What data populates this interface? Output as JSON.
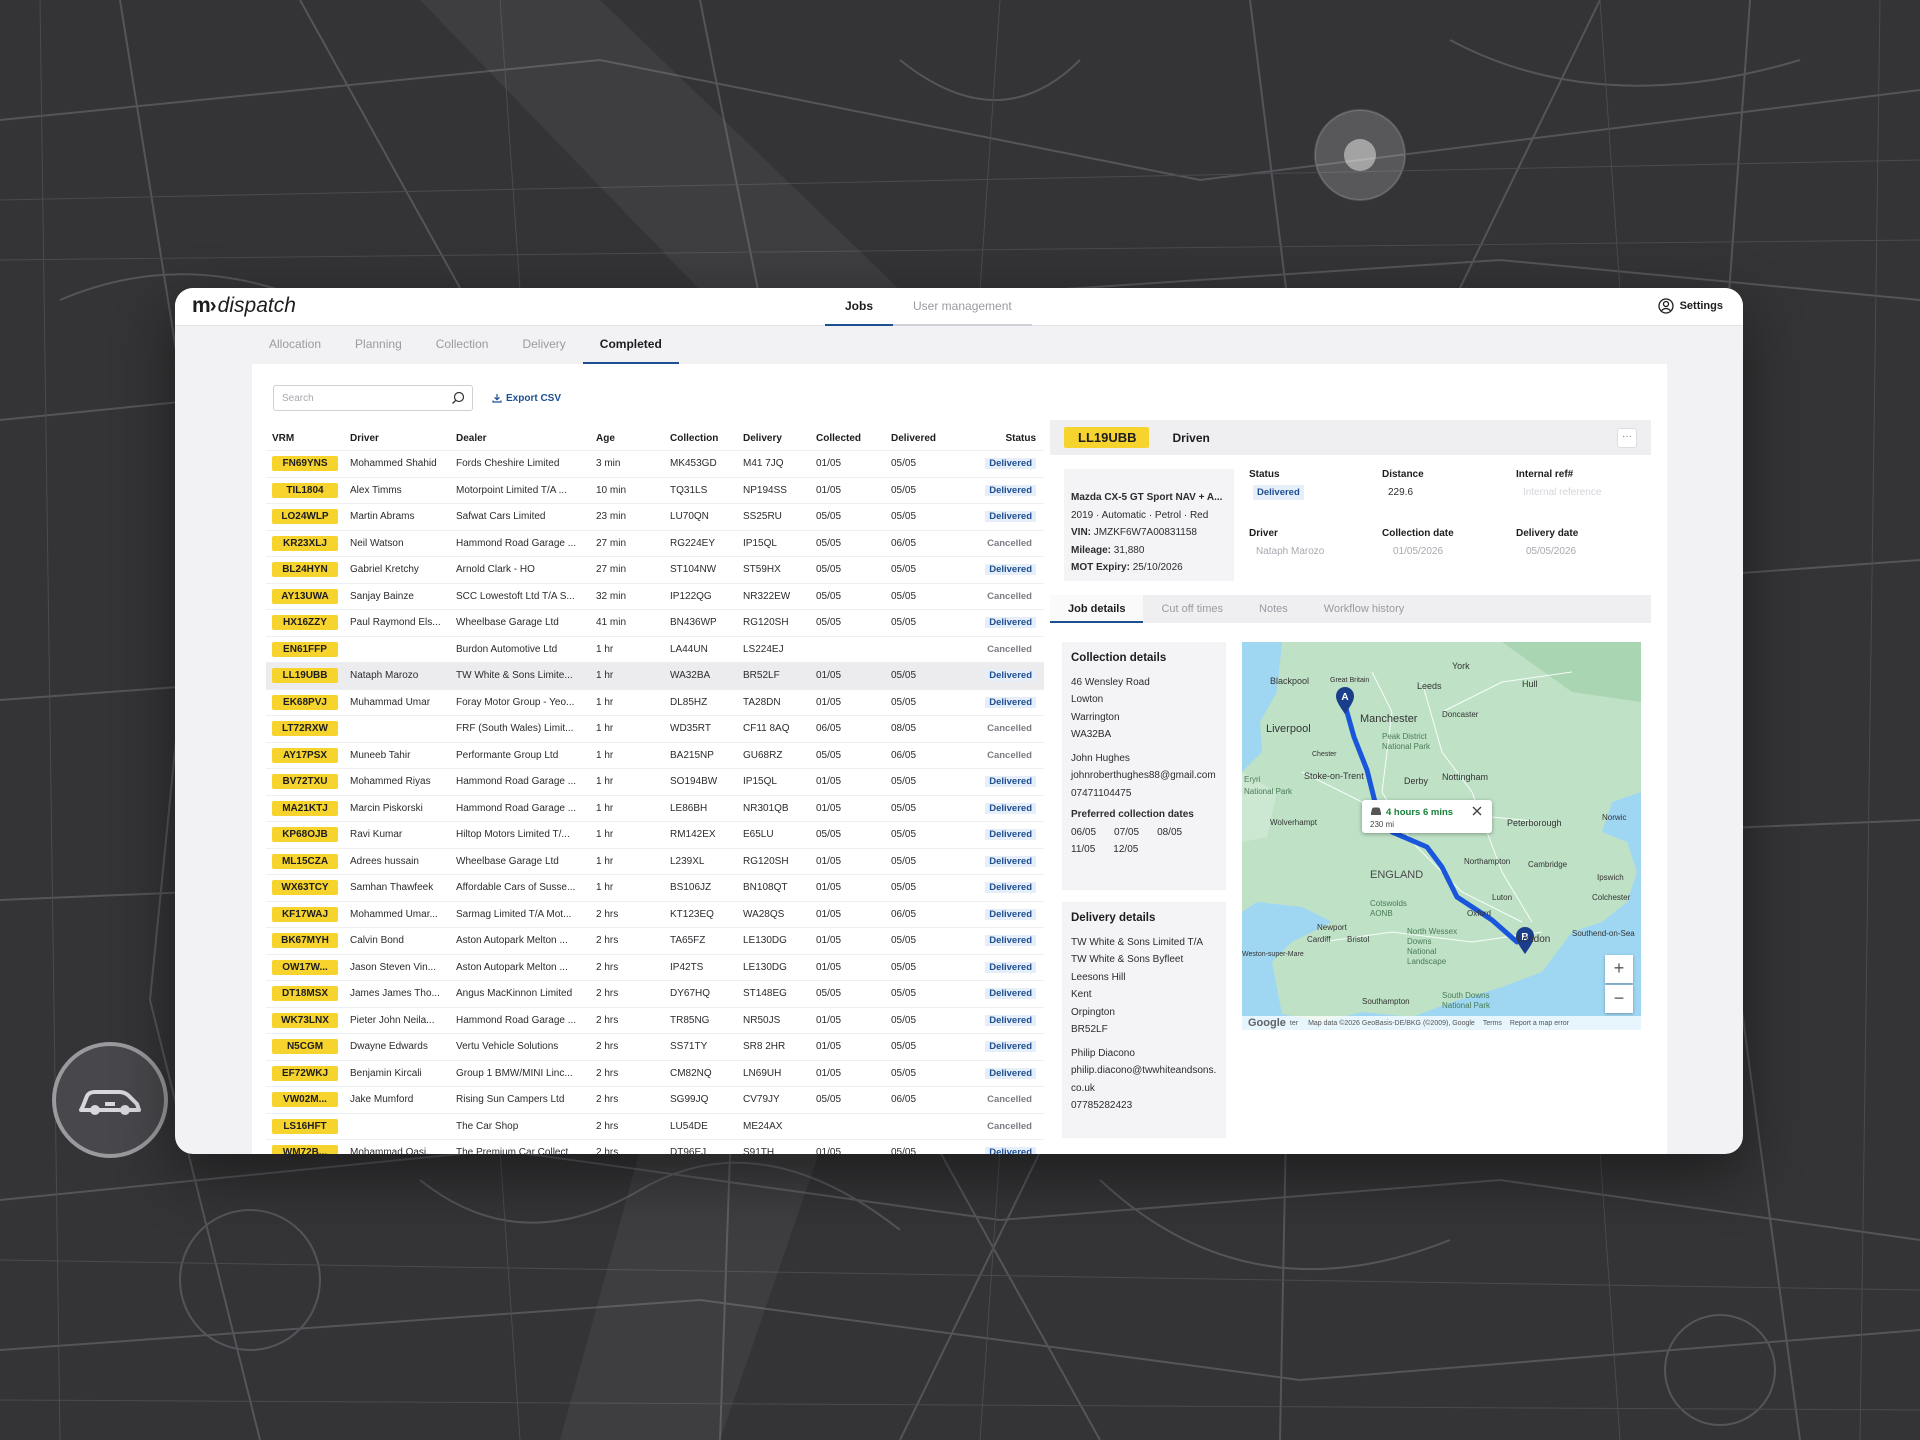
{
  "app": {
    "logo_mark": "m›",
    "logo_text": "dispatch",
    "top_tabs": [
      {
        "label": "Jobs",
        "active": true
      },
      {
        "label": "User management",
        "active": false
      }
    ],
    "settings_label": "Settings"
  },
  "subtabs": [
    {
      "label": "Allocation",
      "active": false
    },
    {
      "label": "Planning",
      "active": false
    },
    {
      "label": "Collection",
      "active": false
    },
    {
      "label": "Delivery",
      "active": false
    },
    {
      "label": "Completed",
      "active": true
    }
  ],
  "toolbar": {
    "search_placeholder": "Search",
    "search_value": "",
    "export_label": "Export CSV"
  },
  "table": {
    "columns": [
      "VRM",
      "Driver",
      "Dealer",
      "Age",
      "Collection",
      "Delivery",
      "Collected",
      "Delivered",
      "Status"
    ],
    "rows": [
      {
        "vrm": "FN69YNS",
        "driver": "Mohammed Shahid",
        "dealer": "Fords Cheshire Limited",
        "age": "3 min",
        "collection": "MK453GD",
        "delivery": "M41 7JQ",
        "collected": "01/05",
        "delivered": "05/05",
        "status": "Delivered"
      },
      {
        "vrm": "TIL1804",
        "driver": "Alex Timms",
        "dealer": "Motorpoint Limited T/A ...",
        "age": "10 min",
        "collection": "TQ31LS",
        "delivery": "NP194SS",
        "collected": "01/05",
        "delivered": "05/05",
        "status": "Delivered"
      },
      {
        "vrm": "LO24WLP",
        "driver": "Martin Abrams",
        "dealer": "Safwat Cars Limited",
        "age": "23 min",
        "collection": "LU70QN",
        "delivery": "SS25RU",
        "collected": "05/05",
        "delivered": "05/05",
        "status": "Delivered"
      },
      {
        "vrm": "KR23XLJ",
        "driver": "Neil Watson",
        "dealer": "Hammond Road Garage ...",
        "age": "27 min",
        "collection": "RG224EY",
        "delivery": "IP15QL",
        "collected": "05/05",
        "delivered": "06/05",
        "status": "Cancelled"
      },
      {
        "vrm": "BL24HYN",
        "driver": "Gabriel Kretchy",
        "dealer": "Arnold Clark - HO",
        "age": "27 min",
        "collection": "ST104NW",
        "delivery": "ST59HX",
        "collected": "05/05",
        "delivered": "05/05",
        "status": "Delivered"
      },
      {
        "vrm": "AY13UWA",
        "driver": "Sanjay Bainze",
        "dealer": "SCC Lowestoft Ltd T/A S...",
        "age": "32 min",
        "collection": "IP122QG",
        "delivery": "NR322EW",
        "collected": "05/05",
        "delivered": "05/05",
        "status": "Cancelled"
      },
      {
        "vrm": "HX16ZZY",
        "driver": "Paul Raymond Els...",
        "dealer": "Wheelbase Garage Ltd",
        "age": "41 min",
        "collection": "BN436WP",
        "delivery": "RG120SH",
        "collected": "05/05",
        "delivered": "05/05",
        "status": "Delivered"
      },
      {
        "vrm": "EN61FFP",
        "driver": "",
        "dealer": "Burdon Automotive Ltd",
        "age": "1 hr",
        "collection": "LA44UN",
        "delivery": "LS224EJ",
        "collected": "",
        "delivered": "",
        "status": "Cancelled"
      },
      {
        "vrm": "LL19UBB",
        "driver": "Nataph Marozo",
        "dealer": "TW White & Sons Limite...",
        "age": "1 hr",
        "collection": "WA32BA",
        "delivery": "BR52LF",
        "collected": "01/05",
        "delivered": "05/05",
        "status": "Delivered",
        "selected": true
      },
      {
        "vrm": "EK68PVJ",
        "driver": "Muhammad Umar",
        "dealer": "Foray Motor Group - Yeo...",
        "age": "1 hr",
        "collection": "DL85HZ",
        "delivery": "TA28DN",
        "collected": "01/05",
        "delivered": "05/05",
        "status": "Delivered"
      },
      {
        "vrm": "LT72RXW",
        "driver": "",
        "dealer": "FRF (South Wales) Limit...",
        "age": "1 hr",
        "collection": "WD35RT",
        "delivery": "CF11 8AQ",
        "collected": "06/05",
        "delivered": "08/05",
        "status": "Cancelled"
      },
      {
        "vrm": "AY17PSX",
        "driver": "Muneeb Tahir",
        "dealer": "Performante Group Ltd",
        "age": "1 hr",
        "collection": "BA215NP",
        "delivery": "GU68RZ",
        "collected": "05/05",
        "delivered": "06/05",
        "status": "Cancelled"
      },
      {
        "vrm": "BV72TXU",
        "driver": "Mohammed Riyas",
        "dealer": "Hammond Road Garage ...",
        "age": "1 hr",
        "collection": "SO194BW",
        "delivery": "IP15QL",
        "collected": "01/05",
        "delivered": "05/05",
        "status": "Delivered"
      },
      {
        "vrm": "MA21KTJ",
        "driver": "Marcin Piskorski",
        "dealer": "Hammond Road Garage ...",
        "age": "1 hr",
        "collection": "LE86BH",
        "delivery": "NR301QB",
        "collected": "01/05",
        "delivered": "05/05",
        "status": "Delivered"
      },
      {
        "vrm": "KP68OJB",
        "driver": "Ravi Kumar",
        "dealer": "Hiltop Motors Limited T/...",
        "age": "1 hr",
        "collection": "RM142EX",
        "delivery": "E65LU",
        "collected": "05/05",
        "delivered": "05/05",
        "status": "Delivered"
      },
      {
        "vrm": "ML15CZA",
        "driver": "Adrees hussain",
        "dealer": "Wheelbase Garage Ltd",
        "age": "1 hr",
        "collection": "L239XL",
        "delivery": "RG120SH",
        "collected": "01/05",
        "delivered": "05/05",
        "status": "Delivered"
      },
      {
        "vrm": "WX63TCY",
        "driver": "Samhan Thawfeek",
        "dealer": "Affordable Cars of Susse...",
        "age": "1 hr",
        "collection": "BS106JZ",
        "delivery": "BN108QT",
        "collected": "01/05",
        "delivered": "05/05",
        "status": "Delivered"
      },
      {
        "vrm": "KF17WAJ",
        "driver": "Mohammed Umar...",
        "dealer": "Sarmag Limited T/A Mot...",
        "age": "2 hrs",
        "collection": "KT123EQ",
        "delivery": "WA28QS",
        "collected": "01/05",
        "delivered": "06/05",
        "status": "Delivered"
      },
      {
        "vrm": "BK67MYH",
        "driver": "Calvin Bond",
        "dealer": "Aston Autopark Melton ...",
        "age": "2 hrs",
        "collection": "TA65FZ",
        "delivery": "LE130DG",
        "collected": "01/05",
        "delivered": "05/05",
        "status": "Delivered"
      },
      {
        "vrm": "OW17W...",
        "driver": "Jason Steven Vin...",
        "dealer": "Aston Autopark Melton ...",
        "age": "2 hrs",
        "collection": "IP42TS",
        "delivery": "LE130DG",
        "collected": "01/05",
        "delivered": "05/05",
        "status": "Delivered"
      },
      {
        "vrm": "DT18MSX",
        "driver": "James James Tho...",
        "dealer": "Angus MacKinnon Limited",
        "age": "2 hrs",
        "collection": "DY67HQ",
        "delivery": "ST148EG",
        "collected": "05/05",
        "delivered": "05/05",
        "status": "Delivered"
      },
      {
        "vrm": "WK73LNX",
        "driver": "Pieter John Neila...",
        "dealer": "Hammond Road Garage ...",
        "age": "2 hrs",
        "collection": "TR85NG",
        "delivery": "NR50JS",
        "collected": "01/05",
        "delivered": "05/05",
        "status": "Delivered"
      },
      {
        "vrm": "N5CGM",
        "driver": "Dwayne Edwards",
        "dealer": "Vertu Vehicle Solutions",
        "age": "2 hrs",
        "collection": "SS71TY",
        "delivery": "SR8 2HR",
        "collected": "01/05",
        "delivered": "05/05",
        "status": "Delivered"
      },
      {
        "vrm": "EF72WKJ",
        "driver": "Benjamin Kircali",
        "dealer": "Group 1 BMW/MINI Linc...",
        "age": "2 hrs",
        "collection": "CM82NQ",
        "delivery": "LN69UH",
        "collected": "01/05",
        "delivered": "05/05",
        "status": "Delivered"
      },
      {
        "vrm": "VW02M...",
        "driver": "Jake Mumford",
        "dealer": "Rising Sun Campers Ltd",
        "age": "2 hrs",
        "collection": "SG99JQ",
        "delivery": "CV79JY",
        "collected": "05/05",
        "delivered": "06/05",
        "status": "Cancelled"
      },
      {
        "vrm": "LS16HFT",
        "driver": "",
        "dealer": "The Car Shop",
        "age": "2 hrs",
        "collection": "LU54DE",
        "delivery": "ME24AX",
        "collected": "",
        "delivered": "",
        "status": "Cancelled"
      },
      {
        "vrm": "WM72B...",
        "driver": "Mohammad Qasi...",
        "dealer": "The Premium Car Collect...",
        "age": "2 hrs",
        "collection": "DT96EJ",
        "delivery": "S91TH",
        "collected": "01/05",
        "delivered": "05/05",
        "status": "Delivered"
      }
    ]
  },
  "detail": {
    "vrm": "LL19UBB",
    "job_type": "Driven",
    "more_label": "···",
    "vehicle": {
      "model": "Mazda CX-5 GT Sport NAV + A...",
      "specs": "2019 · Automatic · Petrol · Red",
      "vin_label": "VIN:",
      "vin": "JMZKF6W7A00831158",
      "mileage_label": "Mileage:",
      "mileage": "31,880",
      "mot_label": "MOT Expiry:",
      "mot": "25/10/2026"
    },
    "status_label": "Status",
    "status": "Delivered",
    "distance_label": "Distance",
    "distance": "229.6",
    "internal_ref_label": "Internal ref#",
    "internal_ref_placeholder": "Internal reference",
    "driver_label": "Driver",
    "driver": "Nataph Marozo",
    "collection_date_label": "Collection date",
    "collection_date": "01/05/2026",
    "delivery_date_label": "Delivery date",
    "delivery_date": "05/05/2026",
    "tabs": [
      {
        "label": "Job details",
        "active": true
      },
      {
        "label": "Cut off times",
        "active": false
      },
      {
        "label": "Notes",
        "active": false
      },
      {
        "label": "Workflow history",
        "active": false
      }
    ],
    "collection": {
      "title": "Collection details",
      "address": [
        "46 Wensley Road",
        "Lowton",
        "Warrington",
        "WA32BA"
      ],
      "contact_name": "John Hughes",
      "contact_email": "johnroberthughes88@gmail.com",
      "contact_phone": "07471104475",
      "preferred_title": "Preferred collection dates",
      "preferred_dates": [
        "06/05",
        "07/05",
        "08/05",
        "11/05",
        "12/05"
      ]
    },
    "delivery": {
      "title": "Delivery details",
      "address": [
        "TW White & Sons Limited T/A",
        "TW White & Sons Byfleet",
        "Leesons Hill",
        "Kent",
        "Orpington",
        "BR52LF"
      ],
      "contact_name": "Philip Diacono",
      "contact_email": "philip.diacono@twwhiteandsons.co.uk",
      "contact_phone": "07785282423"
    },
    "map": {
      "route_time": "4 hours 6 mins",
      "route_distance": "230 mi",
      "marker_a": "A",
      "marker_b": "B",
      "labels": {
        "york": "York",
        "leeds": "Leeds",
        "hull": "Hull",
        "blackpool": "Blackpool",
        "great_britain": "Great Britain",
        "manchester": "Manchester",
        "liverpool": "Liverpool",
        "doncaster": "Doncaster",
        "chester": "Chester",
        "peak": "Peak District",
        "national_park": "National Park",
        "stoke": "Stoke-on-Trent",
        "derby": "Derby",
        "nottingham": "Nottingham",
        "eryri": "Eryri",
        "national_park_2": "National Park",
        "wolverhampton": "Wolverhampt",
        "peterborough": "Peterborough",
        "norwich": "Norwic",
        "northampton": "Northampton",
        "cambridge": "Cambridge",
        "ipswich": "Ipswich",
        "england": "ENGLAND",
        "luton": "Luton",
        "colchester": "Colchester",
        "cotswolds": "Cotswolds",
        "aonb": "AONB",
        "oxford": "Oxford",
        "newport": "Newport",
        "cardiff": "Cardiff",
        "bristol": "Bristol",
        "southend": "Southend-on-Sea",
        "north_wessex": "North Wessex",
        "downs": "Downs",
        "national": "National",
        "landscape": "Landscape",
        "weston": "Weston-super-Mare",
        "london": "London",
        "south_downs": "South Downs",
        "national_park_3": "National Park",
        "southampton": "Southampton"
      },
      "google_label": "Google",
      "keyboard_label": "ter",
      "attribution": "Map data ©2026 GeoBasis-DE/BKG (©2009), Google",
      "terms": "Terms",
      "report": "Report a map error"
    }
  },
  "colors": {
    "accent": "#1d4f91",
    "plate": "#f6d32d",
    "route": "#1a56db",
    "sea": "#9fd7f2",
    "land": "#bfe2c7"
  }
}
